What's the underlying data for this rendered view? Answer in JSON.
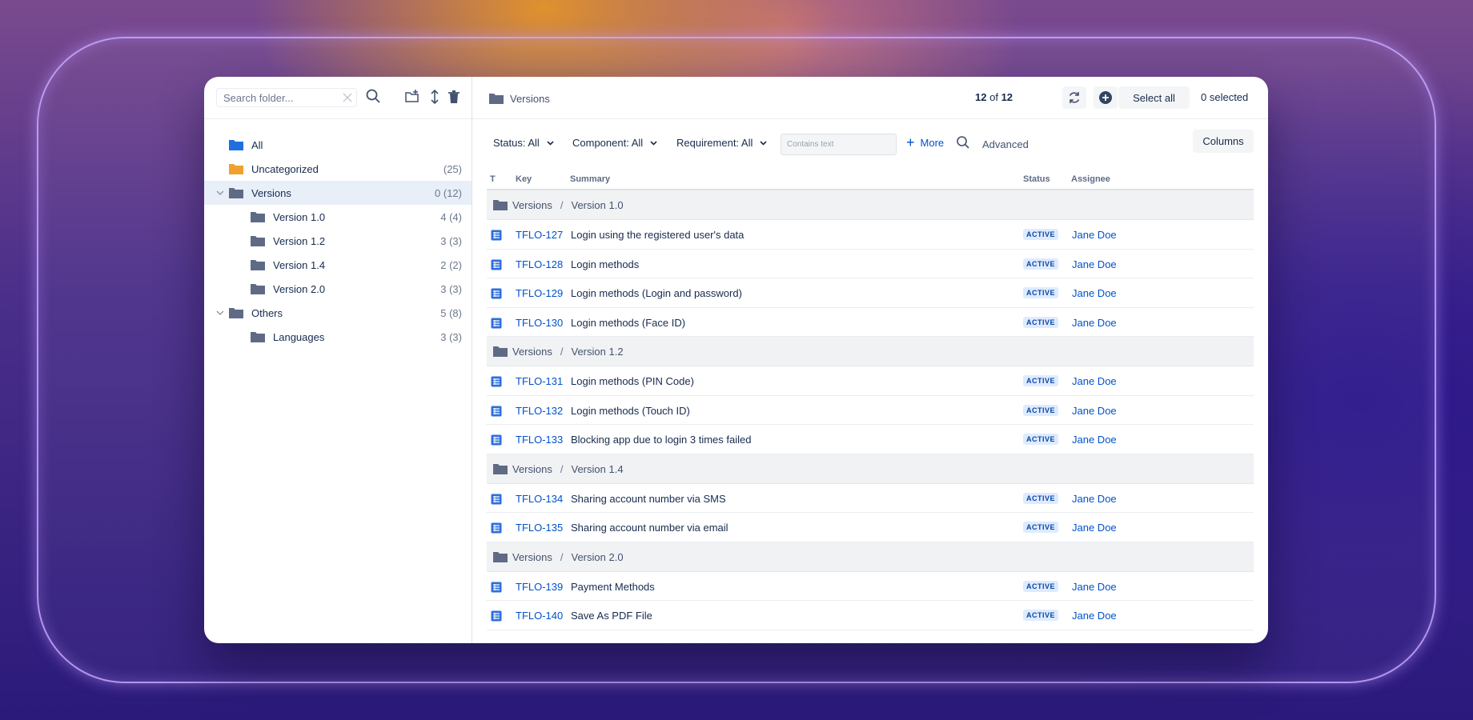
{
  "sidebar": {
    "search_placeholder": "Search folder...",
    "tree": [
      {
        "label": "All",
        "count": "",
        "color": "#1f6fe0",
        "indent": 0,
        "chevron": false,
        "selected": false
      },
      {
        "label": "Uncategorized",
        "count": "(25)",
        "color": "#f0a02d",
        "indent": 0,
        "chevron": false,
        "selected": false
      },
      {
        "label": "Versions",
        "count": "0 (12)",
        "color": "#5f6b85",
        "indent": 0,
        "chevron": true,
        "selected": true
      },
      {
        "label": "Version 1.0",
        "count": "4 (4)",
        "color": "#5f6b85",
        "indent": 1,
        "chevron": false,
        "selected": false
      },
      {
        "label": "Version 1.2",
        "count": "3 (3)",
        "color": "#5f6b85",
        "indent": 1,
        "chevron": false,
        "selected": false
      },
      {
        "label": "Version 1.4",
        "count": "2 (2)",
        "color": "#5f6b85",
        "indent": 1,
        "chevron": false,
        "selected": false
      },
      {
        "label": "Version 2.0",
        "count": "3 (3)",
        "color": "#5f6b85",
        "indent": 1,
        "chevron": false,
        "selected": false
      },
      {
        "label": "Others",
        "count": "5 (8)",
        "color": "#5f6b85",
        "indent": 0,
        "chevron": true,
        "selected": false
      },
      {
        "label": "Languages",
        "count": "3 (3)",
        "color": "#5f6b85",
        "indent": 1,
        "chevron": false,
        "selected": false
      }
    ]
  },
  "header": {
    "breadcrumb": "Versions",
    "count_current": "12",
    "count_of": "of",
    "count_total": "12",
    "select_all": "Select all",
    "selected": "0 selected"
  },
  "filters": {
    "status": "Status: All",
    "component": "Component: All",
    "requirement": "Requirement: All",
    "contains_placeholder": "Contains text",
    "more": "More",
    "advanced": "Advanced",
    "columns": "Columns"
  },
  "table": {
    "headers": {
      "t": "T",
      "key": "Key",
      "summary": "Summary",
      "status": "Status",
      "assignee": "Assignee"
    },
    "groups": [
      {
        "path": "Versions",
        "sub": "Version 1.0",
        "rows": [
          {
            "key": "TFLO-127",
            "summary": "Login using the registered user's data",
            "status": "ACTIVE",
            "assignee": "Jane Doe"
          },
          {
            "key": "TFLO-128",
            "summary": "Login methods",
            "status": "ACTIVE",
            "assignee": "Jane Doe"
          },
          {
            "key": "TFLO-129",
            "summary": "Login methods (Login and password)",
            "status": "ACTIVE",
            "assignee": "Jane Doe"
          },
          {
            "key": "TFLO-130",
            "summary": "Login methods (Face ID)",
            "status": "ACTIVE",
            "assignee": "Jane Doe"
          }
        ]
      },
      {
        "path": "Versions",
        "sub": "Version 1.2",
        "rows": [
          {
            "key": "TFLO-131",
            "summary": "Login methods (PIN Code)",
            "status": "ACTIVE",
            "assignee": "Jane Doe"
          },
          {
            "key": "TFLO-132",
            "summary": "Login methods (Touch ID)",
            "status": "ACTIVE",
            "assignee": "Jane Doe"
          },
          {
            "key": "TFLO-133",
            "summary": "Blocking app due to login 3 times failed",
            "status": "ACTIVE",
            "assignee": "Jane Doe"
          }
        ]
      },
      {
        "path": "Versions",
        "sub": "Version 1.4",
        "rows": [
          {
            "key": "TFLO-134",
            "summary": "Sharing account number via SMS",
            "status": "ACTIVE",
            "assignee": "Jane Doe"
          },
          {
            "key": "TFLO-135",
            "summary": "Sharing account number via email",
            "status": "ACTIVE",
            "assignee": "Jane Doe"
          }
        ]
      },
      {
        "path": "Versions",
        "sub": "Version 2.0",
        "rows": [
          {
            "key": "TFLO-139",
            "summary": "Payment Methods",
            "status": "ACTIVE",
            "assignee": "Jane Doe"
          },
          {
            "key": "TFLO-140",
            "summary": "Save As PDF File",
            "status": "ACTIVE",
            "assignee": "Jane Doe"
          }
        ]
      }
    ]
  }
}
